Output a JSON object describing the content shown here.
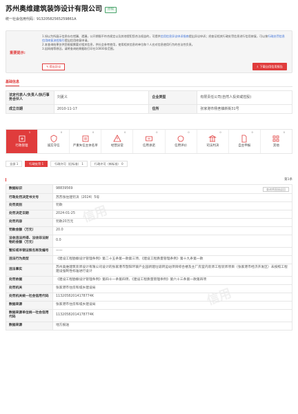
{
  "company": {
    "name": "苏州奥维建筑装饰设计有限公司",
    "status": "存续",
    "credit_label": "统一社会信用代码：",
    "credit_code": "91320582565259861A"
  },
  "notice": {
    "label": "重要提示:",
    "line1": "1.如以为所展示信息存在错漏、遗漏，公开期限不符合规定以及其他侵犯您合法权益的，可提供",
    "line1_link": "信用信息异议申诉指南",
    "line1b": "提出异议申诉；经查证相关行政处罚信息进行信用修复，可以按",
    "line1_link2": "行政处罚信息信用修复流程指引",
    "line1c": "提出信用修复申请。",
    "line2": "2.本查询结果仅供您根据需要对相关信息，供社会参考使用，使用相关信息的单位和个人应对信息使用行为的合法性负责。",
    "line3": "3.因网络等原因，请将查询结果截取打印在10000条范围。",
    "btn_objection": "提出异议",
    "btn_download": "下载自用信用报告"
  },
  "section_title": "基础信息",
  "basic": {
    "legal_rep_label": "法定代表人/负责人/执行事务合伙人",
    "legal_rep": "刘夏义",
    "type_label": "企业类型",
    "type": "有限责任公司(自然人投资或控股)",
    "founded_label": "成立日期",
    "founded": "2010-11-17",
    "address_label": "住所",
    "address": "张家港市杨舍镇新街31号"
  },
  "categories": [
    {
      "label": "行政管理",
      "count": "1",
      "icon": "gavel-icon"
    },
    {
      "label": "诚实守信",
      "count": "0",
      "icon": "shield-icon"
    },
    {
      "label": "严重失信主体名单",
      "count": "0",
      "icon": "list-icon"
    },
    {
      "label": "经营异常",
      "count": "0",
      "icon": "alert-icon"
    },
    {
      "label": "信用承诺",
      "count": "0",
      "icon": "handshake-icon"
    },
    {
      "label": "信用评价",
      "count": "0",
      "icon": "star-icon"
    },
    {
      "label": "司法判决",
      "count": "0",
      "icon": "court-icon"
    },
    {
      "label": "自主申报",
      "count": "0",
      "icon": "document-icon"
    },
    {
      "label": "其他",
      "count": "0",
      "icon": "grid-icon"
    }
  ],
  "filters": [
    {
      "label": "全部",
      "count": "1"
    },
    {
      "label": "行政处罚",
      "count": "1"
    },
    {
      "label": "行政许可（旧标准）",
      "count": "1"
    },
    {
      "label": "行政许可（新标准）",
      "count": "0"
    }
  ],
  "record_total": "第1条",
  "detail": {
    "rows": [
      {
        "k": "数据标识",
        "v": "98839569"
      },
      {
        "k": "行政处罚决定书文号",
        "v": "苏苏张住建罚决〔2024〕5号"
      },
      {
        "k": "处罚类别",
        "v": "罚款"
      },
      {
        "k": "处罚决定日期",
        "v": "2024-01-25"
      },
      {
        "k": "处罚内容",
        "v": "罚款20万元"
      },
      {
        "k": "罚款金额（万元）",
        "v": "20.0"
      },
      {
        "k": "没收违法所得、没收非法财物的金额（万元）",
        "v": "0.0"
      },
      {
        "k": "暂扣或吊销证照名称及编号",
        "v": "——"
      },
      {
        "k": "违法行为类型",
        "v": "《建设工程勘察设计管理条例》第二十五条第一款第三项、《建设工程质量管理条例》第十九条第一款"
      },
      {
        "k": "违法事实",
        "v": "苏州奥维建筑装饰设计有限公司设计的张家港市暨阳环玻产业园新建垃圾转运站项目综合楼及主厂房室内装饰工程装饰项目（张家港市经济开发区）未按照工程建设强制性标准进行设计"
      },
      {
        "k": "处罚依据",
        "v": "《建设工程勘察设计管理条例》第四十一条第四项、《建设工程质量管理条例》第六十三条第一款第四项"
      },
      {
        "k": "处罚机关",
        "v": "张家港市住房和城乡建设局"
      },
      {
        "k": "处罚机关统一社会信用代码",
        "v": "11320582014178774K"
      },
      {
        "k": "数据来源",
        "v": "张家港市住房和城乡建设局"
      },
      {
        "k": "数据来源单位统一社会信用代码",
        "v": "11320582014178774K"
      },
      {
        "k": "数据来源",
        "v": "地方报送"
      }
    ],
    "copy_btn": "查询将直接返回"
  }
}
